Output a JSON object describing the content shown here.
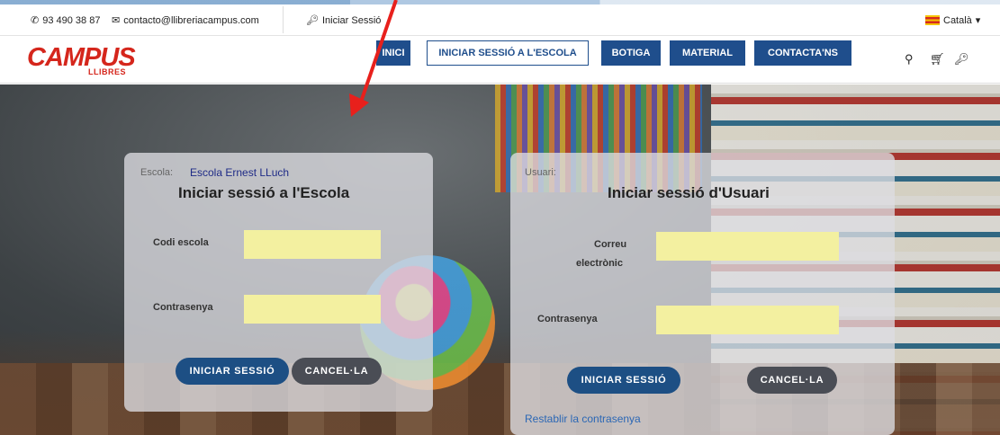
{
  "topbar": {
    "phone": "93 490 38 87",
    "email": "contacto@llibreriacampus.com",
    "login": "Iniciar Sessió",
    "language": "Català"
  },
  "logo": {
    "main": "CAMPUS",
    "sub": "LLIBRES"
  },
  "nav": {
    "items": [
      "INICI",
      "INICIAR SESSIÓ A L'ESCOLA",
      "BOTIGA",
      "MATERIAL",
      "CONTACTA'NS"
    ]
  },
  "school_panel": {
    "school_label": "Escola:",
    "school_name": "Escola Ernest LLuch",
    "title": "Iniciar sessió a l'Escola",
    "code_label": "Codi escola",
    "password_label": "Contrasenya",
    "submit": "INICIAR SESSIÓ",
    "cancel": "CANCEL·LA"
  },
  "user_panel": {
    "user_label": "Usuari:",
    "title": "Iniciar sessió d'Usuari",
    "email_label_1": "Correu",
    "email_label_2": "electrònic",
    "password_label": "Contrasenya",
    "submit": "INICIAR SESSIÓ",
    "cancel": "CANCEL·LA",
    "reset_link": "Restablir la contrasenya"
  },
  "colors": {
    "brand_red": "#d5261c",
    "nav_blue": "#1f4e8c",
    "field_yellow": "#f3f0a0"
  }
}
